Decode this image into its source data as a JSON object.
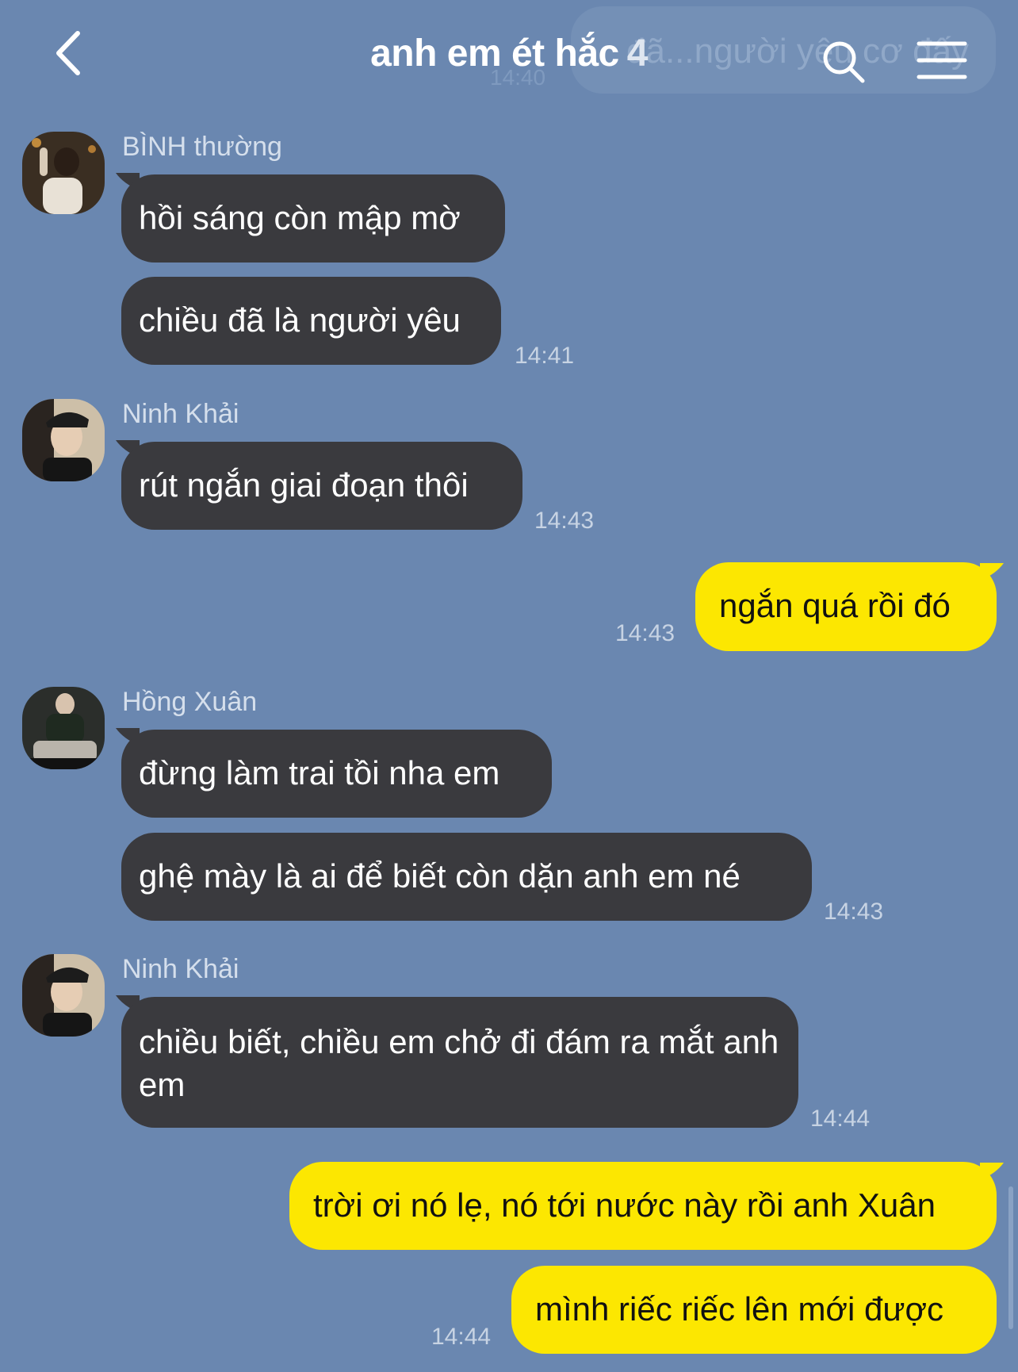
{
  "ghost": {
    "text": "đã...người yêu cơ đấy",
    "time": "14:40"
  },
  "header": {
    "title": "anh em ét hắc",
    "member_count": "4"
  },
  "icons": {
    "back": "chevron-left-icon",
    "search": "search-icon",
    "menu": "hamburger-menu-icon"
  },
  "colors": {
    "background": "#6a87b0",
    "incoming_bubble": "#3a3a3e",
    "outgoing_bubble": "#fce701"
  },
  "messages": [
    {
      "sender": "BÌNH thường",
      "texts": [
        "hồi sáng còn mập mờ",
        "chiều đã là người yêu"
      ],
      "time": "14:41"
    },
    {
      "sender": "Ninh Khải",
      "texts": [
        "rút ngắn giai đoạn thôi"
      ],
      "time": "14:43"
    },
    {
      "mine": true,
      "texts": [
        "ngắn quá rồi đó"
      ],
      "time": "14:43"
    },
    {
      "sender": "Hồng Xuân",
      "texts": [
        "đừng làm trai tồi nha em",
        "ghệ mày là ai để biết còn dặn anh em né"
      ],
      "time": "14:43"
    },
    {
      "sender": "Ninh Khải",
      "texts": [
        "chiều biết, chiều em chở đi đám ra mắt anh em"
      ],
      "time": "14:44"
    },
    {
      "mine": true,
      "texts": [
        "trời ơi nó lẹ, nó tới nước này rồi anh Xuân",
        "mình riếc riếc lên mới được"
      ],
      "time": "14:44"
    }
  ]
}
